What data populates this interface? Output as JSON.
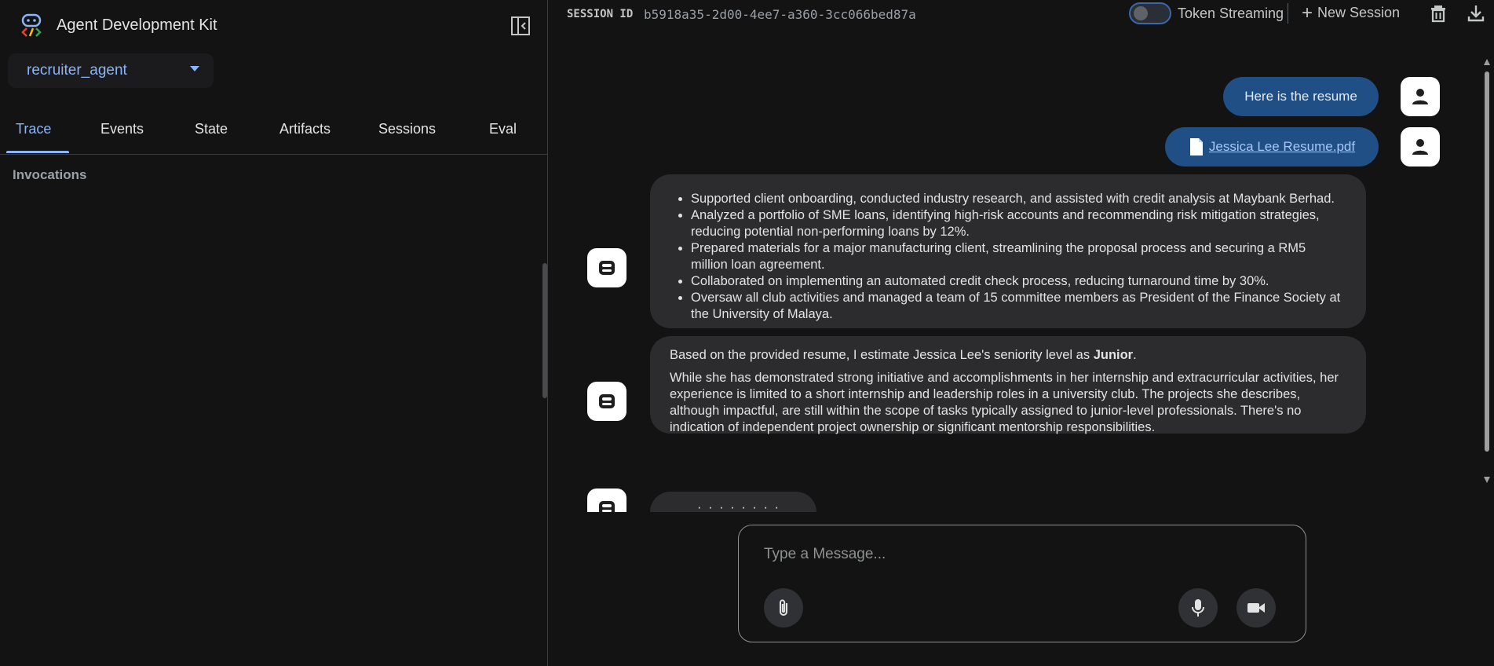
{
  "app": {
    "title": "Agent Development Kit"
  },
  "sidebar": {
    "agent_selected": "recruiter_agent",
    "tabs": [
      {
        "label": "Trace",
        "active": true
      },
      {
        "label": "Events"
      },
      {
        "label": "State"
      },
      {
        "label": "Artifacts"
      },
      {
        "label": "Sessions"
      },
      {
        "label": "Eval"
      }
    ],
    "section_label": "Invocations"
  },
  "header": {
    "session_label": "SESSION ID",
    "session_id": "b5918a35-2d00-4ee7-a360-3cc066bed87a",
    "token_streaming_label": "Token Streaming",
    "token_streaming_on": false,
    "new_session_label": "New Session"
  },
  "chat": {
    "messages": [
      {
        "role": "user",
        "text": "Here is the resume"
      },
      {
        "role": "user",
        "file": "Jessica Lee Resume.pdf"
      },
      {
        "role": "agent",
        "bullets": [
          "Supported client onboarding, conducted industry research, and assisted with credit analysis at Maybank Berhad.",
          "Analyzed a portfolio of SME loans, identifying high-risk accounts and recommending risk mitigation strategies, reducing potential non-performing loans by 12%.",
          "Prepared materials for a major manufacturing client, streamlining the proposal process and securing a RM5 million loan agreement.",
          "Collaborated on implementing an automated credit check process, reducing turnaround time by 30%.",
          "Oversaw all club activities and managed a team of 15 committee members as President of the Finance Society at the University of Malaya."
        ]
      },
      {
        "role": "agent",
        "p1_prefix": "Based on the provided resume, I estimate Jessica Lee's seniority level as ",
        "p1_bold": "Junior",
        "p1_suffix": ".",
        "p2": "While she has demonstrated strong initiative and accomplishments in her internship and extracurricular activities, her experience is limited to a short internship and leadership roles in a university club. The projects she describes, although impactful, are still within the scope of tasks typically assigned to junior-level professionals. There's no indication of independent project ownership or significant mentorship responsibilities."
      },
      {
        "role": "agent",
        "loading_text": "· · · · · · · ·"
      }
    ]
  },
  "input": {
    "placeholder": "Type a Message...",
    "value": ""
  },
  "colors": {
    "accent": "#8ab4f8",
    "user_bubble": "#1f4f84",
    "bot_bubble": "#2c2c2e",
    "background": "#131314"
  }
}
